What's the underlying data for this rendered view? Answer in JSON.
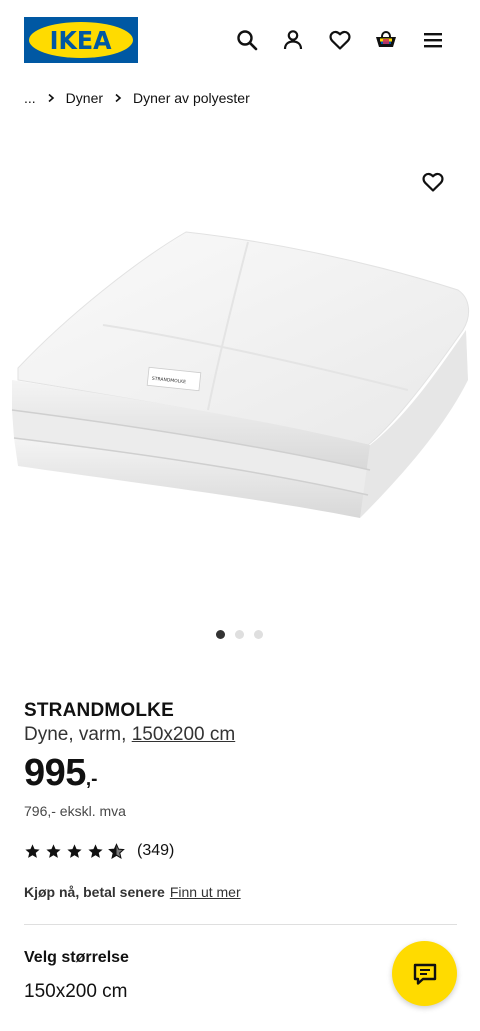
{
  "header": {
    "logo_text": "IKEA",
    "colors": {
      "brand_blue": "#0058a3",
      "brand_yellow": "#ffdb00"
    },
    "icons": [
      "search-icon",
      "account-icon",
      "heart-icon",
      "cart-icon",
      "menu-icon"
    ]
  },
  "breadcrumb": {
    "ellipsis": "...",
    "items": [
      "Dyner",
      "Dyner av polyester"
    ]
  },
  "gallery": {
    "product_label": "STRANDMOLKE",
    "image_count": 3,
    "active_index": 0
  },
  "product": {
    "name": "STRANDMOLKE",
    "desc_prefix": "Dyne, varm, ",
    "size_link": "150x200 cm",
    "price_int": "995",
    "price_dec": ",-",
    "price_ex_vat": "796,- ekskl. mva",
    "rating": 4.5,
    "rating_count": "(349)",
    "financing_text": "Kjøp nå, betal senere",
    "financing_link": "Finn ut mer",
    "size_label": "Velg størrelse",
    "size_value": "150x200 cm"
  },
  "chat": {
    "icon": "chat-icon",
    "color": "#ffdb00"
  }
}
